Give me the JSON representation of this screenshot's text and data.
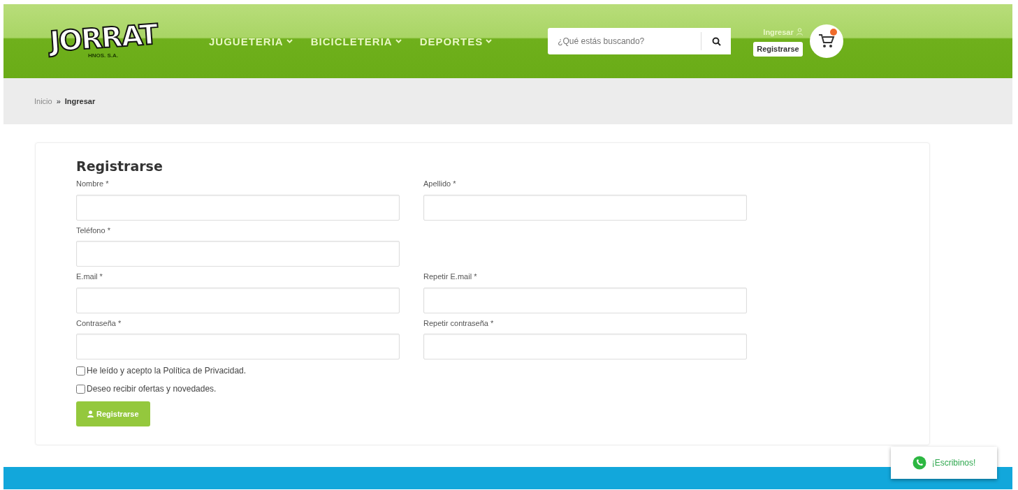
{
  "header": {
    "logo": {
      "text": "JORRAT",
      "subtext": "HNOS. S.A."
    },
    "nav": [
      {
        "label": "JUGUETERIA"
      },
      {
        "label": "BICICLETERIA"
      },
      {
        "label": "DEPORTES"
      }
    ],
    "search": {
      "placeholder": "¿Qué estás buscando?"
    },
    "login": "Ingresar",
    "register": "Registrarse"
  },
  "breadcrumb_separator": "»",
  "breadcrumb": [
    {
      "label": "Inicio",
      "current": false
    },
    {
      "label": "Ingresar",
      "current": true
    }
  ],
  "form": {
    "title": "Registrarse",
    "rows": [
      [
        {
          "label": "Nombre *"
        },
        {
          "label": "Apellido *"
        }
      ],
      [
        {
          "label": "Teléfono *"
        }
      ],
      [
        {
          "label": "E.mail *"
        },
        {
          "label": "Repetir E.mail *"
        }
      ],
      [
        {
          "label": "Contraseña *"
        },
        {
          "label": "Repetir contraseña *"
        }
      ]
    ],
    "checkboxes": [
      {
        "label": "He leído y acepto la Política de Privacidad.",
        "checked": false
      },
      {
        "label": "Deseo recibir ofertas y novedades.",
        "checked": false
      }
    ],
    "submit": "Registrarse"
  },
  "whatsapp": "¡Escribinos!"
}
